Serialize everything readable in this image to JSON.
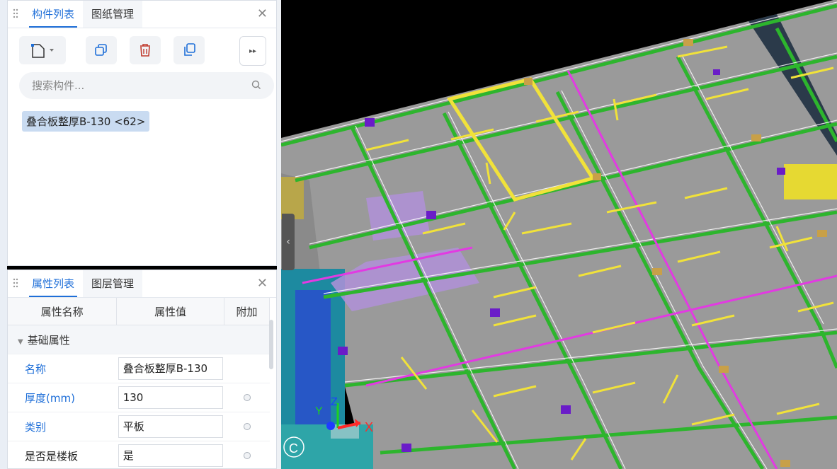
{
  "top_panel": {
    "tabs": [
      {
        "label": "构件列表",
        "active": true
      },
      {
        "label": "图纸管理",
        "active": false
      }
    ],
    "toolbar": {
      "new": "new-component",
      "copy": "copy",
      "delete": "delete",
      "copy_floor": "copy-to-floor",
      "more": "more"
    },
    "search": {
      "placeholder": "搜索构件..."
    },
    "items": [
      {
        "label": "叠合板整厚B-130 <62>",
        "selected": true
      }
    ]
  },
  "bottom_panel": {
    "tabs": [
      {
        "label": "属性列表",
        "active": true
      },
      {
        "label": "图层管理",
        "active": false
      }
    ],
    "columns": [
      "属性名称",
      "属性值",
      "附加"
    ],
    "group": "基础属性",
    "rows": [
      {
        "name": "名称",
        "value": "叠合板整厚B-130",
        "highlight": true,
        "extra": false
      },
      {
        "name": "厚度(mm)",
        "value": "130",
        "highlight": true,
        "extra": true
      },
      {
        "name": "类别",
        "value": "平板",
        "highlight": true,
        "extra": true
      },
      {
        "name": "是否是楼板",
        "value": "是",
        "highlight": false,
        "extra": true
      }
    ]
  },
  "viewport": {
    "axis_labels": {
      "x": "X",
      "y": "Y",
      "z": "Z",
      "c": "C"
    },
    "colors": {
      "slab": "#9a9a9a",
      "beam": "#2db52d",
      "yellow": "#f1e23a",
      "magenta": "#e23ae2",
      "purple": "#6a1cc8",
      "orange": "#c8a048",
      "blue": "#1e3cff",
      "teal": "#1c8aa0"
    }
  }
}
